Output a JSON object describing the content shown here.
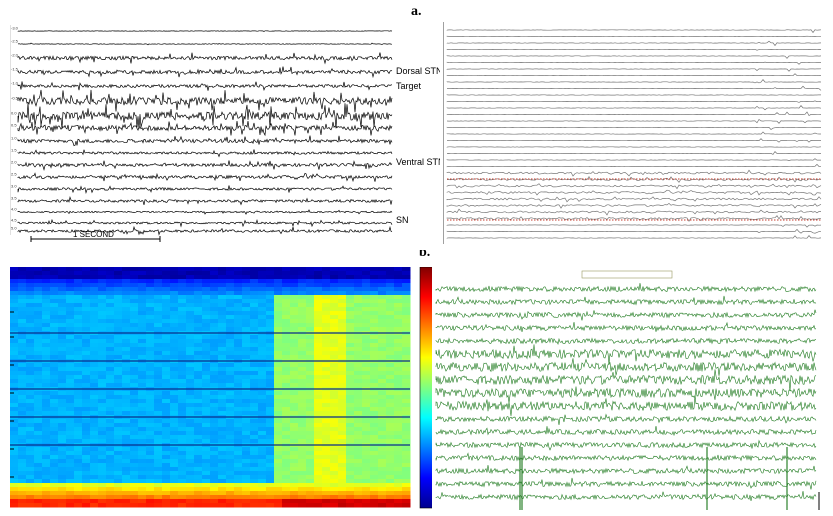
{
  "figure": {
    "label_a": "a.",
    "label_b": "b."
  },
  "panel_a_left": {
    "track_labels": [
      "Dorsal STN",
      "Target",
      "Ventral STN",
      "SN"
    ],
    "depth_labels": [
      "-3.0",
      "-2.5",
      "-2.0",
      "-1.5",
      "-1.0",
      "-0.5",
      "0.0",
      "0.5",
      "1.0",
      "1.5",
      "2.0",
      "2.5",
      "3.0",
      "3.5",
      "4.0",
      "4.5",
      "5.0"
    ],
    "scale_bar_label": "1 SECOND"
  },
  "panel_a_right": {
    "trace_color": "#777777",
    "highlight_color": "#c0392b"
  },
  "panel_b_left": {
    "colormap": "jet"
  },
  "panel_b_right": {
    "trace_color": "#1e7a1e"
  }
}
